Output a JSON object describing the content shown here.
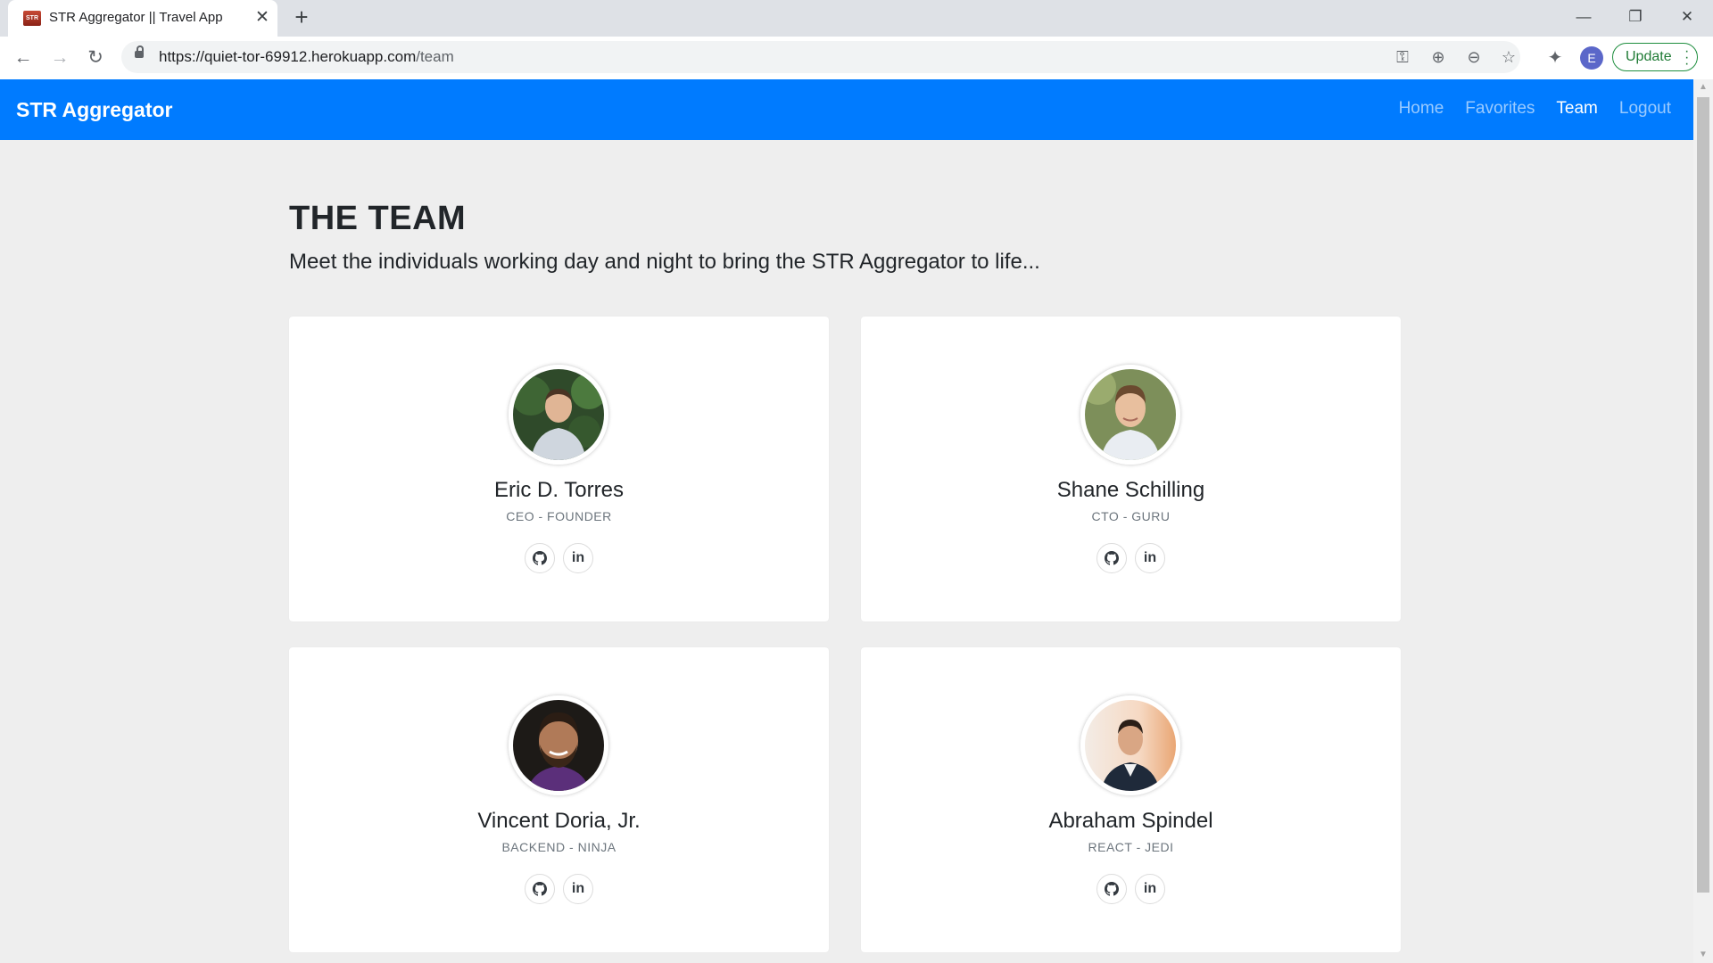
{
  "browser": {
    "tab_title": "STR Aggregator || Travel App",
    "favicon_text": "STR",
    "url_domain": "https://quiet-tor-69912.herokuapp.com",
    "url_path": "/team",
    "profile_initial": "E",
    "update_label": "Update"
  },
  "nav": {
    "brand": "STR Aggregator",
    "links": [
      "Home",
      "Favorites",
      "Team",
      "Logout"
    ],
    "active": "Team",
    "bg_color": "#007bff"
  },
  "page": {
    "heading": "THE TEAM",
    "lead": "Meet the individuals working day and night to bring the STR Aggregator to life..."
  },
  "team": [
    {
      "name": "Eric D. Torres",
      "role": "CEO - FOUNDER"
    },
    {
      "name": "Shane Schilling",
      "role": "CTO - GURU"
    },
    {
      "name": "Vincent Doria, Jr.",
      "role": "BACKEND - NINJA"
    },
    {
      "name": "Abraham Spindel",
      "role": "REACT - JEDI"
    }
  ],
  "icons": {
    "github": "github-icon",
    "linkedin": "linkedin-icon",
    "linkedin_text": "in"
  }
}
